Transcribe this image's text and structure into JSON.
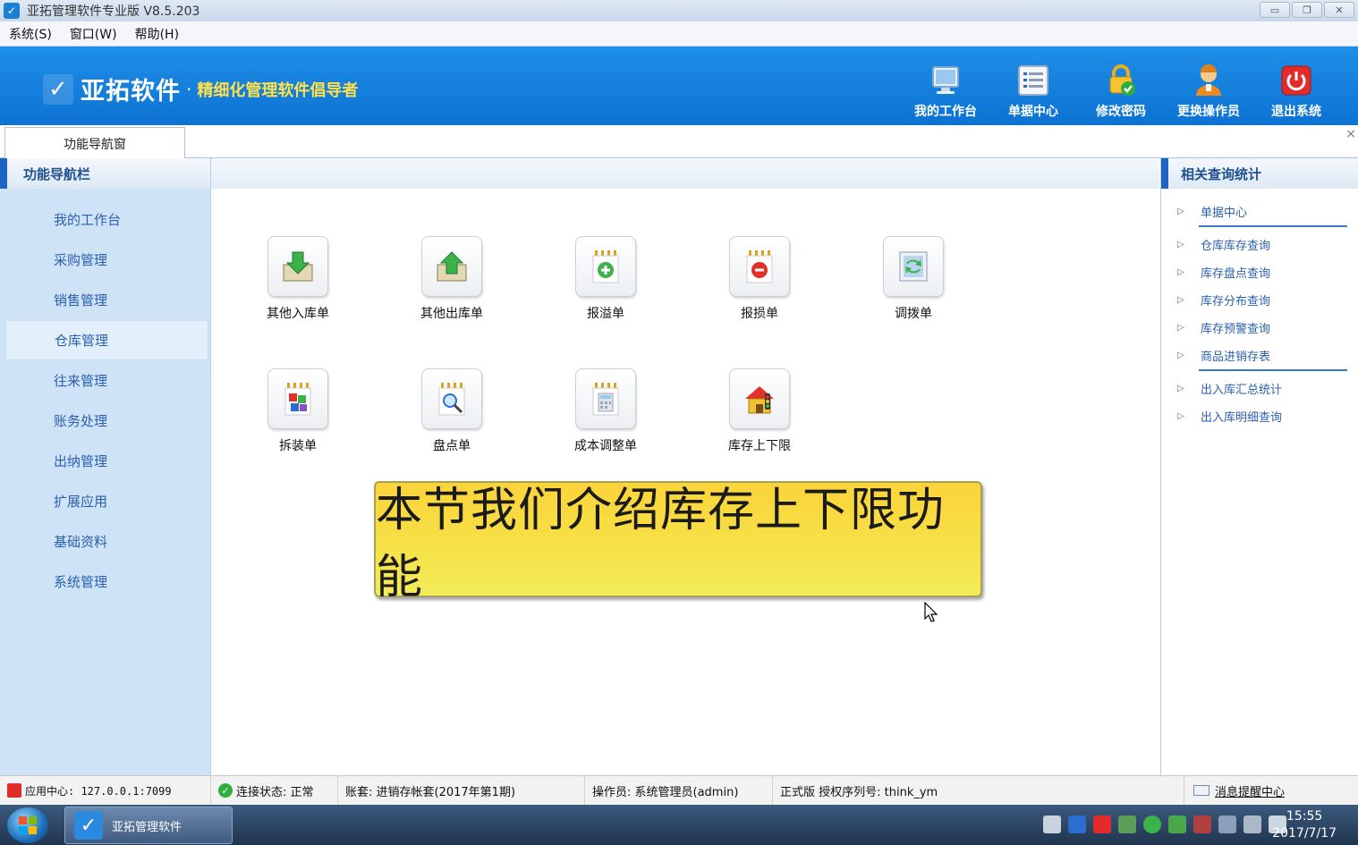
{
  "window": {
    "title": "亚拓管理软件专业版 V8.5.203",
    "minimize": "▭",
    "maximize": "❐",
    "close": "✕"
  },
  "menu": [
    "系统(S)",
    "窗口(W)",
    "帮助(H)"
  ],
  "banner": {
    "logo_name": "亚拓软件",
    "dot": "·",
    "slogan": "精细化管理软件倡导者"
  },
  "toolbar": [
    {
      "label": "我的工作台",
      "icon": "monitor-icon"
    },
    {
      "label": "单据中心",
      "icon": "list-icon"
    },
    {
      "label": "修改密码",
      "icon": "lock-icon"
    },
    {
      "label": "更换操作员",
      "icon": "user-icon"
    },
    {
      "label": "退出系统",
      "icon": "power-icon"
    }
  ],
  "tab": {
    "label": "功能导航窗",
    "close": "×"
  },
  "leftnav": {
    "title": "功能导航栏",
    "items": [
      "我的工作台",
      "采购管理",
      "销售管理",
      "仓库管理",
      "往来管理",
      "账务处理",
      "出纳管理",
      "扩展应用",
      "基础资料",
      "系统管理"
    ],
    "active": "仓库管理"
  },
  "functions": [
    {
      "label": "其他入库单",
      "icon": "inbound-icon"
    },
    {
      "label": "其他出库单",
      "icon": "outbound-icon"
    },
    {
      "label": "报溢单",
      "icon": "overflow-icon"
    },
    {
      "label": "报损单",
      "icon": "loss-icon"
    },
    {
      "label": "调拨单",
      "icon": "transfer-icon"
    },
    {
      "label": "拆装单",
      "icon": "assembly-icon"
    },
    {
      "label": "盘点单",
      "icon": "stocktake-icon"
    },
    {
      "label": "成本调整单",
      "icon": "cost-adjust-icon"
    },
    {
      "label": "库存上下限",
      "icon": "stock-limit-icon"
    }
  ],
  "caption": "本节我们介绍库存上下限功能",
  "rightpanel": {
    "title": "相关查询统计",
    "items": [
      "单据中心",
      "仓库库存查询",
      "库存盘点查询",
      "库存分布查询",
      "库存预警查询",
      "商品进销存表",
      "出入库汇总统计",
      "出入库明细查询"
    ]
  },
  "statusbar": {
    "app_center": "应用中心: 127.0.0.1:7099",
    "connection": "连接状态: 正常",
    "account": "账套: 进销存帐套(2017年第1期)",
    "operator": "操作员: 系统管理员(admin)",
    "license": "正式版 授权序列号: think_ym",
    "message": "消息提醒中心"
  },
  "taskbar": {
    "app_label": "亚拓管理软件",
    "time": "15:55",
    "date": "2017/7/17"
  }
}
